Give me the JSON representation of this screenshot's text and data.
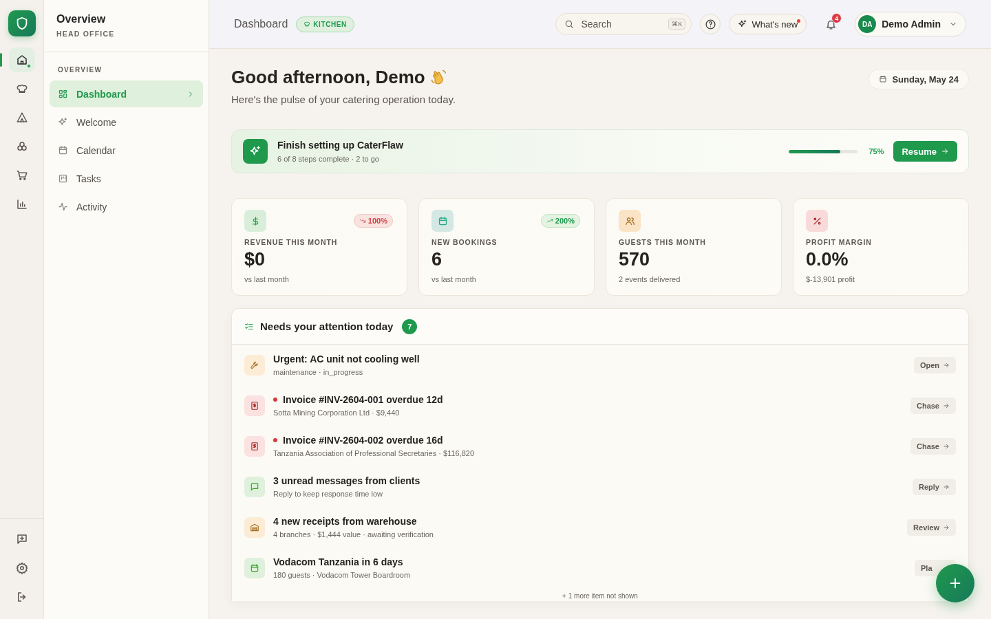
{
  "rail": {
    "items": [
      {
        "kind": "home",
        "selected": true,
        "dot": true
      },
      {
        "kind": "chef",
        "selected": false,
        "dot": false
      },
      {
        "kind": "tent",
        "selected": false,
        "dot": false
      },
      {
        "kind": "flower",
        "selected": false,
        "dot": false
      },
      {
        "kind": "cart",
        "selected": false,
        "dot": false
      },
      {
        "kind": "chart",
        "selected": false,
        "dot": false
      }
    ],
    "bottom": [
      {
        "kind": "feedback"
      },
      {
        "kind": "settings"
      },
      {
        "kind": "logout"
      }
    ]
  },
  "sidebar": {
    "title": "Overview",
    "subtitle": "HEAD OFFICE",
    "section": "OVERVIEW",
    "items": [
      {
        "label": "Dashboard",
        "kind": "grid",
        "selected": true
      },
      {
        "label": "Welcome",
        "kind": "sparkle",
        "selected": false
      },
      {
        "label": "Calendar",
        "kind": "calendar",
        "selected": false
      },
      {
        "label": "Tasks",
        "kind": "tasks",
        "selected": false
      },
      {
        "label": "Activity",
        "kind": "activity",
        "selected": false
      }
    ]
  },
  "header": {
    "title": "Dashboard",
    "tag": "KITCHEN",
    "search": {
      "placeholder": "Search",
      "shortcut": "⌘K"
    },
    "whats_new": {
      "label": "What's new",
      "dot": true
    },
    "notifications": {
      "count": "4"
    },
    "user": {
      "initials": "DA",
      "name": "Demo Admin"
    }
  },
  "greeting": {
    "title": "Good afternoon, Demo",
    "subtitle": "Here's the pulse of your catering operation today.",
    "date": "Sunday, May 24"
  },
  "setup": {
    "title": "Finish setting up CaterFlaw",
    "subtitle": "6 of 8 steps complete · 2 to go",
    "level": 0.75,
    "percent": "75%",
    "button": "Resume"
  },
  "stats": [
    {
      "kind": "dollar",
      "color": "#d8eedb",
      "label": "REVENUE THIS MONTH",
      "value": "$0",
      "note": "vs last month",
      "trend": {
        "text": "100%",
        "rising": false
      }
    },
    {
      "kind": "calendar",
      "color": "#d3e8e2",
      "label": "NEW BOOKINGS",
      "value": "6",
      "note": "vs last month",
      "trend": {
        "text": "200%",
        "rising": true
      }
    },
    {
      "kind": "users",
      "color": "#fbe3c6",
      "label": "GUESTS THIS MONTH",
      "value": "570",
      "note": "2 events delivered"
    },
    {
      "kind": "percent",
      "color": "#f8dada",
      "label": "PROFIT MARGIN",
      "value": "0.0%",
      "note": "$-13,901 profit"
    }
  ],
  "attention": {
    "title": "Needs your attention today",
    "count": "7",
    "items": [
      {
        "kind": "wrench",
        "color": "#fcecd6",
        "title": "Urgent: AC unit not cooling well",
        "subtitle": "maintenance · in_progress",
        "action": "Open",
        "overdue": false
      },
      {
        "kind": "invoice",
        "color": "#fbe1e0",
        "title": "Invoice #INV-2604-001 overdue 12d",
        "subtitle": "Sotta Mining Corporation Ltd · $9,440",
        "action": "Chase",
        "overdue": true
      },
      {
        "kind": "invoice",
        "color": "#fbe1e0",
        "title": "Invoice #INV-2604-002 overdue 16d",
        "subtitle": "Tanzania Association of Professional Secretaries · $116,820",
        "action": "Chase",
        "overdue": true
      },
      {
        "kind": "message",
        "color": "#dff0dc",
        "title": "3 unread messages from clients",
        "subtitle": "Reply to keep response time low",
        "action": "Reply",
        "overdue": false
      },
      {
        "kind": "warehouse",
        "color": "#fcecd6",
        "title": "4 new receipts from warehouse",
        "subtitle": "4 branches · $1,444 value · awaiting verification",
        "action": "Review",
        "overdue": false
      },
      {
        "kind": "calendar",
        "color": "#dff0dc",
        "title": "Vodacom Tanzania in 6 days",
        "subtitle": "180 guests · Vodacom Tower Boardroom",
        "action": "Pla",
        "overdue": false
      }
    ],
    "more": "+ 1 more item not shown"
  }
}
